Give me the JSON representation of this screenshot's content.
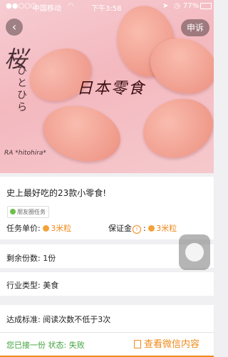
{
  "status_bar": {
    "carrier": "中国移动",
    "time": "下午3:58",
    "battery": "77%"
  },
  "hero": {
    "back_icon": "chevron-left-icon",
    "complain_label": "申诉",
    "brand_text": "日本零食",
    "sakura_text": "桜",
    "vertical_text": "ひとひら",
    "sub_brand": "RA *hitohira*"
  },
  "task": {
    "title": "史上最好吃的23款小零食!",
    "tag_label": "朋友圈任务",
    "unit_price_label": "任务单价:",
    "unit_price_value": "3米粒",
    "deposit_label": "保证金",
    "deposit_value": "3米粒",
    "remaining_label": "剩余份数:",
    "remaining_value": "1份",
    "industry_label": "行业类型:",
    "industry_value": "美食",
    "standard_label": "达成标准:",
    "standard_value": "阅读次数不低于3次"
  },
  "bottom_bar": {
    "status_text": "您已接一份 状态: 失败",
    "view_button_label": "查看微信内容"
  },
  "colors": {
    "accent": "#f08a1c",
    "success": "#3fa33a"
  }
}
